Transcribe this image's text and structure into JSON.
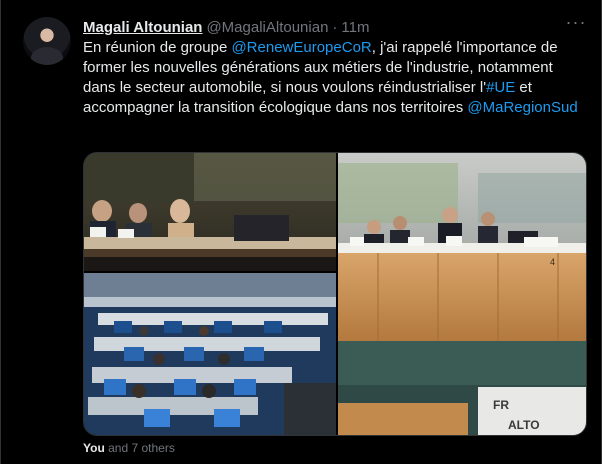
{
  "tweet": {
    "author_name": "Magali Altounian",
    "author_handle": "@MagaliAltounian",
    "separator": "·",
    "time": "11m",
    "more_icon": "more-horizontal-icon",
    "text_parts": {
      "p1": "En réunion de groupe ",
      "mention1": "@RenewEuropeCoR",
      "p2": ", j'ai rappelé l'importance de former les nouvelles générations aux métiers de l'industrie, notamment dans le secteur automobile, si nous voulons réindustrialiser l'",
      "hashtag": "#UE",
      "p3": " et accompagner la transition écologique dans nos territoires ",
      "mention2": "@MaRegionSud"
    },
    "social": {
      "you": "You",
      "others": " and 7 others"
    },
    "photo_c_signs": {
      "fr": "FR",
      "alto": "ALTO",
      "num": "4"
    }
  },
  "colors": {
    "background": "#000000",
    "text": "#e7e9ea",
    "muted": "#71767b",
    "link": "#1d9bf0",
    "border": "#2f3336"
  }
}
